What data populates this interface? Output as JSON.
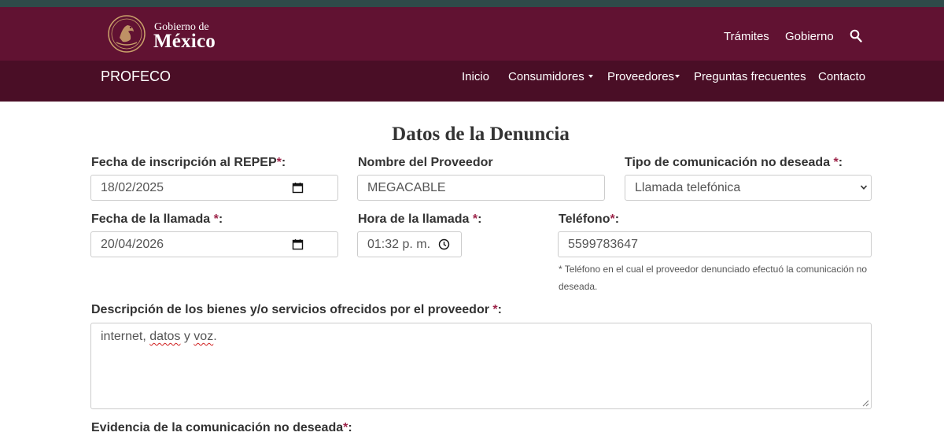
{
  "colors": {
    "top_strip": "#2f4a49",
    "gov_bar": "#611232",
    "sub_nav": "#4a0e26",
    "required": "#9d2449"
  },
  "gov_header": {
    "logo_line1": "Gobierno de",
    "logo_line2": "México",
    "links": [
      "Trámites",
      "Gobierno"
    ],
    "search_icon": "search-icon"
  },
  "sub_nav": {
    "brand": "PROFECO",
    "items": [
      {
        "label": "Inicio",
        "dropdown": false
      },
      {
        "label": "Consumidores",
        "dropdown": true
      },
      {
        "label": "Proveedores",
        "dropdown": true
      },
      {
        "label": "Preguntas frecuentes",
        "dropdown": false
      },
      {
        "label": "Contacto",
        "dropdown": false
      }
    ]
  },
  "form": {
    "title": "Datos de la Denuncia",
    "fecha_repep": {
      "label": "Fecha de inscripción al REPEP",
      "value": "18/02/2025"
    },
    "proveedor": {
      "label": "Nombre del Proveedor",
      "value": "MEGACABLE"
    },
    "tipo_comunicacion": {
      "label": "Tipo de comunicación no deseada",
      "value": "Llamada telefónica"
    },
    "fecha_llamada": {
      "label": "Fecha de la llamada",
      "value": "20/04/2026"
    },
    "hora_llamada": {
      "label": "Hora de la llamada",
      "value": "01:32 p. m."
    },
    "telefono": {
      "label": "Teléfono",
      "value": "5599783647",
      "help": "* Teléfono en el cual el proveedor denunciado efectuó la comunicación no deseada."
    },
    "descripcion": {
      "label": "Descripción de los bienes y/o servicios ofrecidos por el proveedor",
      "value_start": "internet, ",
      "value_word1": "datos",
      "value_mid": " y ",
      "value_word2": "voz",
      "value_end": "."
    },
    "evidencia": {
      "label": "Evidencia de la comunicación no deseada"
    },
    "required_mark": "*",
    "colon": ":"
  }
}
